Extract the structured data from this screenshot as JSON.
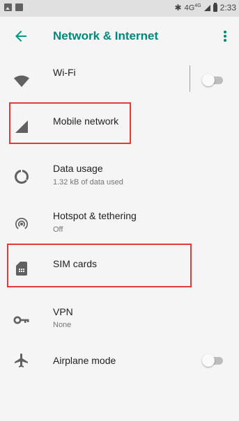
{
  "status_bar": {
    "bluetooth": "✱",
    "network": "4G",
    "network_sup": "4G",
    "time": "2:33"
  },
  "app_bar": {
    "title": "Network & Internet"
  },
  "items": [
    {
      "label": "Wi-Fi",
      "icon": "wifi-icon"
    },
    {
      "label": "Mobile network",
      "icon": "cell-signal-icon"
    },
    {
      "label": "Data usage",
      "sub": "1.32 kB of data used",
      "icon": "data-usage-icon"
    },
    {
      "label": "Hotspot & tethering",
      "sub": "Off",
      "icon": "hotspot-icon"
    },
    {
      "label": "SIM cards",
      "icon": "sim-card-icon"
    },
    {
      "label": "VPN",
      "sub": "None",
      "icon": "vpn-key-icon"
    },
    {
      "label": "Airplane mode",
      "icon": "airplane-icon"
    }
  ],
  "toggles": {
    "wifi": "off",
    "airplane": "off"
  },
  "colors": {
    "accent": "#00897b",
    "highlight": "#e53935"
  }
}
